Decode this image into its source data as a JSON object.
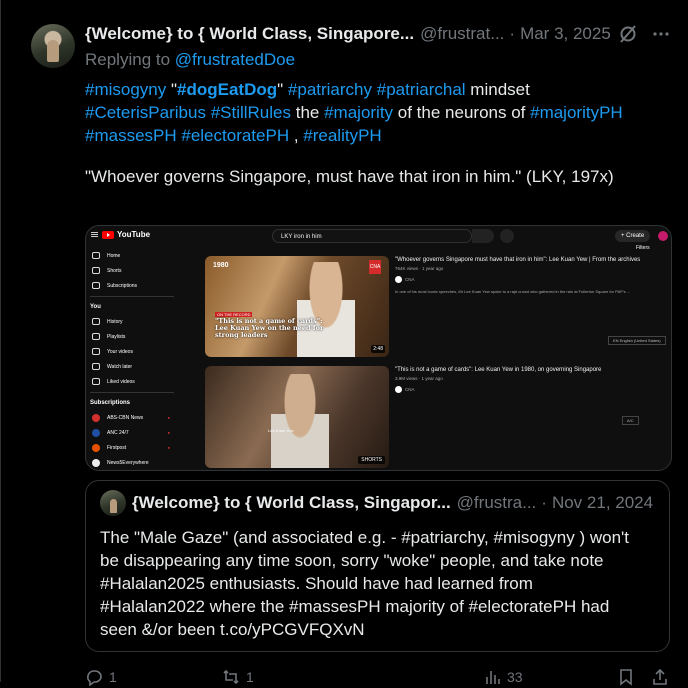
{
  "post": {
    "display_name": "{Welcome} to { World Class, Singapore...",
    "handle": "@frustrat...",
    "separator": "·",
    "date": "Mar 3, 2025",
    "replying_prefix": "Replying to",
    "replying_handle": "@frustratedDoe",
    "line1": {
      "t1": "#misogyny",
      "t2": " \"",
      "t3": "#dogEatDog",
      "t4": "\" ",
      "t5": "#patriarchy",
      "t6": " ",
      "t7": "#patriarchal",
      "t8": " mindset"
    },
    "line2": {
      "t1": "#CeterisParibus",
      "t2": " ",
      "t3": "#StillRules",
      "t4": " the ",
      "t5": "#majority",
      "t6": " of the neurons of ",
      "t7": "#majorityPH"
    },
    "line3": {
      "t1": "#massesPH",
      "t2": " ",
      "t3": "#electoratePH",
      "t4": " , ",
      "t5": "#realityPH"
    },
    "quote_text": "\"Whoever governs Singapore, must have that iron in him.\" (LKY, 197x)"
  },
  "media": {
    "yt_logo": "YouTube",
    "search_query": "LKY iron in him",
    "create_label": "+ Create",
    "filters_label": "Filters",
    "sidebar": {
      "items": [
        "Home",
        "Shorts",
        "Subscriptions"
      ],
      "you_label": "You",
      "you_items": [
        "History",
        "Playlists",
        "Your videos",
        "Watch later",
        "Liked videos"
      ],
      "subs_label": "Subscriptions",
      "subs": [
        {
          "name": "ABS-CBN News",
          "color": "#d32f2f"
        },
        {
          "name": "ANC 24/7",
          "color": "#1e4fa3"
        },
        {
          "name": "Firstpost",
          "color": "#e65100"
        },
        {
          "name": "News5Everywhere",
          "color": "#eeeeee"
        }
      ]
    },
    "video1": {
      "year": "1980",
      "logo": "CNA",
      "tag": "ON THE RECORD",
      "caption": "\"This is not a game of cards\": Lee Kuan Yew on the need for strong leaders",
      "duration": "2:48",
      "title": "\"Whoever governs Singapore must have that iron in him\": Lee Kuan Yew | From the archives",
      "meta": "764K views · 1 year ago",
      "channel": "CNA",
      "desc": "In one of his most iconic speeches, Mr Lee Kuan Yew spoke to a rapt crowd who gathered in the rain at Fullerton Square for PAP's ...",
      "chip": "EN English (United States)"
    },
    "video2": {
      "cap": "Lee Kuan Yew",
      "badge": "SHORTS",
      "title": "\"This is not a game of cards\": Lee Kuan Yew in 1980, on governing Singapore",
      "meta": "3.9M views · 1 year ago",
      "channel": "CNA",
      "chip": "A/C"
    }
  },
  "quoted": {
    "display_name": "{Welcome} to { World Class, Singapor...",
    "handle": "@frustra...",
    "separator": "·",
    "date": "Nov 21, 2024",
    "lines": [
      "The \"Male Gaze\" (and associated e.g. - #patriarchy, #misogyny ) won't",
      "be disappearing any time soon, sorry \"woke\" people, and take note",
      "#Halalan2025 enthusiasts. Should have had learned from",
      "#Halalan2022 where the #massesPH majority of #electoratePH had",
      "seen &/or been t.co/yPCGVFQXvN"
    ]
  },
  "actions": {
    "reply_count": "1",
    "repost_count": "1",
    "views_count": "33"
  },
  "colors": {
    "link": "#1d9bf0",
    "muted": "#71767b",
    "text": "#e7e9ea",
    "border": "#2f3336"
  },
  "icons": [
    "grok-icon",
    "more-icon",
    "reply-icon",
    "repost-icon",
    "views-icon",
    "bookmark-icon",
    "share-icon"
  ]
}
